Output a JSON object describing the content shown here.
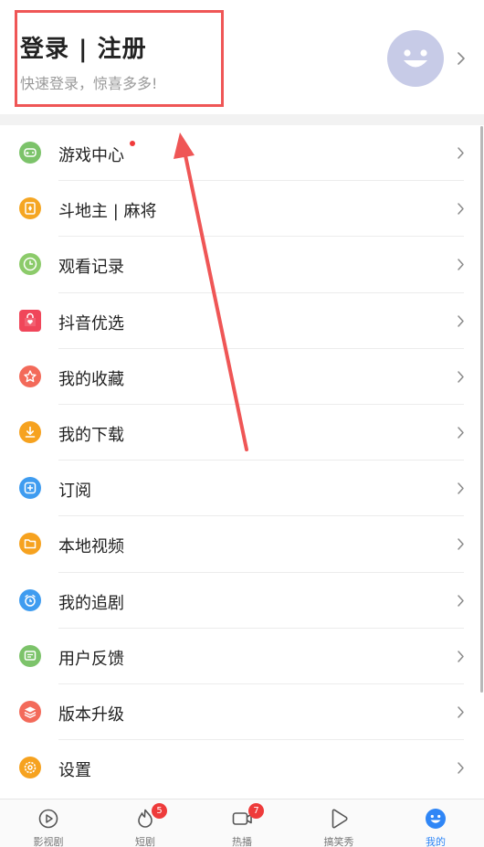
{
  "header": {
    "title": "登录 | 注册",
    "subtitle": "快速登录，惊喜多多!"
  },
  "menu": [
    {
      "label": "游戏中心",
      "icon": "gamepad-icon",
      "color": "#7cc36a",
      "dot": true
    },
    {
      "label": "斗地主 | 麻将",
      "icon": "cards-icon",
      "color": "#f5a623",
      "dot": false
    },
    {
      "label": "观看记录",
      "icon": "clock-icon",
      "color": "#8ccb6a",
      "dot": false
    },
    {
      "label": "抖音优选",
      "icon": "shopping-bag-icon",
      "color": "#f0465a",
      "dot": false
    },
    {
      "label": "我的收藏",
      "icon": "star-icon",
      "color": "#f36a5a",
      "dot": false
    },
    {
      "label": "我的下载",
      "icon": "download-icon",
      "color": "#f6a21f",
      "dot": false
    },
    {
      "label": "订阅",
      "icon": "subscribe-icon",
      "color": "#3f9cf0",
      "dot": false
    },
    {
      "label": "本地视频",
      "icon": "folder-icon",
      "color": "#f6a21f",
      "dot": false
    },
    {
      "label": "我的追剧",
      "icon": "alarm-icon",
      "color": "#3f9cf0",
      "dot": false
    },
    {
      "label": "用户反馈",
      "icon": "feedback-icon",
      "color": "#7cc36a",
      "dot": false
    },
    {
      "label": "版本升级",
      "icon": "layers-icon",
      "color": "#f36a5a",
      "dot": false
    },
    {
      "label": "设置",
      "icon": "gear-icon",
      "color": "#f6a21f",
      "dot": false
    }
  ],
  "bottom_nav": [
    {
      "label": "影视剧",
      "icon": "play-circle-icon",
      "badge": null,
      "active": false
    },
    {
      "label": "短剧",
      "icon": "flame-icon",
      "badge": "5",
      "active": false
    },
    {
      "label": "热播",
      "icon": "video-icon",
      "badge": "7",
      "active": false
    },
    {
      "label": "搞笑秀",
      "icon": "play-triangle-icon",
      "badge": null,
      "active": false
    },
    {
      "label": "我的",
      "icon": "smiley-icon",
      "badge": null,
      "active": true
    }
  ],
  "colors": {
    "accent": "#2f86f6",
    "annotation": "#ef5656",
    "avatar": "#c7cbe7",
    "badge": "#ee3b3b"
  }
}
